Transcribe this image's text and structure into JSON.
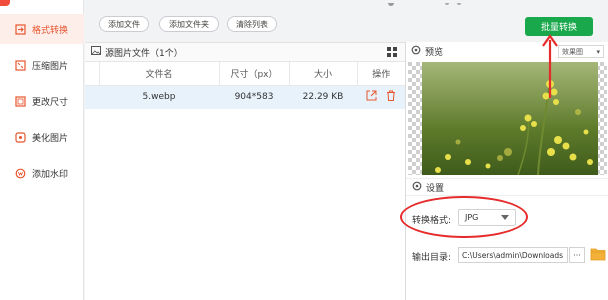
{
  "sidebar": {
    "items": [
      {
        "label": "格式转换",
        "icon": "format-convert-icon",
        "active": true
      },
      {
        "label": "压缩图片",
        "icon": "compress-icon",
        "active": false
      },
      {
        "label": "更改尺寸",
        "icon": "resize-icon",
        "active": false
      },
      {
        "label": "美化图片",
        "icon": "beautify-icon",
        "active": false
      },
      {
        "label": "添加水印",
        "icon": "watermark-icon",
        "active": false
      }
    ]
  },
  "toolbar": {
    "add_file": "添加文件",
    "add_folder": "添加文件夹",
    "clear_list": "清除列表",
    "batch_convert": "批量转换"
  },
  "file_panel": {
    "title": "源图片文件（1个）",
    "columns": [
      "文件名",
      "尺寸（px）",
      "大小",
      "操作"
    ],
    "rows": [
      {
        "name": "5.webp",
        "size_px": "904*583",
        "size": "22.29 KB"
      }
    ]
  },
  "preview": {
    "title": "预览",
    "effect_label": "效果图"
  },
  "settings": {
    "title": "设置",
    "format_label": "转换格式:",
    "format_value": "JPG",
    "output_label": "输出目录:",
    "output_value": "C:\\Users\\admin\\Downloads",
    "more": "···"
  },
  "colors": {
    "accent": "#e8552e",
    "primary_green": "#1aa84c",
    "annotation_red": "#e52b2b"
  }
}
